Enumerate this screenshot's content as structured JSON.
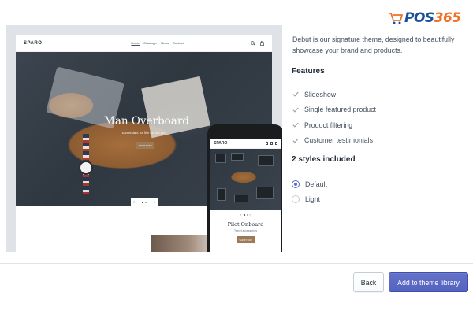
{
  "brand": {
    "name_part": "POS",
    "number_part": "365",
    "text_color": "#1a4fa0",
    "number_color": "#f26f24",
    "icon": "shopping-cart-icon"
  },
  "preview": {
    "desktop": {
      "logo": "SPARO",
      "menu": [
        "Home",
        "Catalog ▾",
        "News",
        "Contact"
      ],
      "actions": [
        "search-icon",
        "bag-icon"
      ],
      "hero_title": "Man Overboard",
      "hero_subtitle": "Essentials for life on the go",
      "hero_button": "SHOP NOW",
      "slider_prev": "‹",
      "slider_next": "›"
    },
    "mobile": {
      "logo": "SPARO",
      "title": "Pilot Onboard",
      "subtitle": "Travel accessories",
      "button": "SHOP NOW",
      "slider_prev": "‹",
      "slider_next": "›"
    }
  },
  "details": {
    "description": "Debut is our signature theme, designed to beautifully showcase your brand and products.",
    "features_heading": "Features",
    "features": [
      "Slideshow",
      "Single featured product",
      "Product filtering",
      "Customer testimonials"
    ],
    "styles_heading": "2 styles included",
    "styles": [
      {
        "label": "Default",
        "selected": true
      },
      {
        "label": "Light",
        "selected": false
      }
    ]
  },
  "footer": {
    "back_label": "Back",
    "primary_label": "Add to theme library"
  },
  "colors": {
    "accent": "#5c6ac4",
    "check": "#919eab",
    "text": "#212b36",
    "preview_bg": "#dfe3e8"
  }
}
